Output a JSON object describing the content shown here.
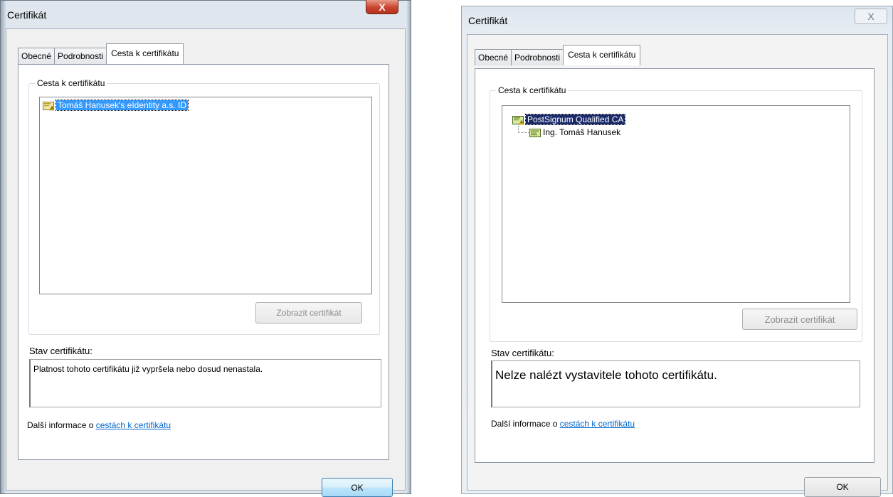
{
  "dialog_left": {
    "title": "Certifikát",
    "close_glyph": "X",
    "tabs": [
      "Obecné",
      "Podrobnosti",
      "Cesta k certifikátu"
    ],
    "group_label": "Cesta k certifikátu",
    "tree_items": [
      {
        "label": "Tomáš Hanusek's eIdentity a.s. ID",
        "icon": "certificate-warning-icon",
        "selected": true
      }
    ],
    "view_button": "Zobrazit certifikát",
    "status_label": "Stav certifikátu:",
    "status_text": "Platnost tohoto certifikátu již vypršela nebo dosud nenastala.",
    "info_prefix": "Další informace o ",
    "info_link": "cestách k certifikátu",
    "ok_button": "OK"
  },
  "dialog_right": {
    "title": "Certifikát",
    "close_glyph": "X",
    "tabs": [
      "Obecné",
      "Podrobnosti",
      "Cesta k certifikátu"
    ],
    "group_label": "Cesta k certifikátu",
    "tree_items": [
      {
        "label": "PostSignum Qualified CA",
        "icon": "certificate-warning-icon",
        "selected": true
      },
      {
        "label": "Ing. Tomáš Hanusek",
        "icon": "certificate-icon",
        "selected": false
      }
    ],
    "view_button": "Zobrazit certifikát",
    "status_label": "Stav certifikátu:",
    "status_text": "Nelze nalézt vystavitele tohoto certifikátu.",
    "info_prefix": "Další informace o ",
    "info_link": "cestách k certifikátu",
    "ok_button": "OK"
  }
}
